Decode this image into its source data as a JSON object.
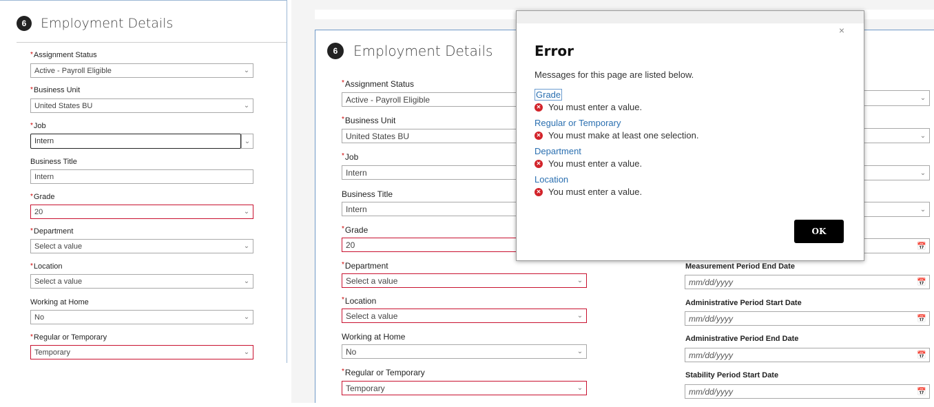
{
  "section": {
    "number": "6",
    "title": "Employment Details"
  },
  "left": {
    "fields": [
      {
        "label": "Assignment Status",
        "required": true,
        "value": "Active - Payroll Eligible"
      },
      {
        "label": "Business Unit",
        "required": true,
        "value": "United States BU"
      },
      {
        "label": "Job",
        "required": true,
        "value": "Intern"
      },
      {
        "label": "Business Title",
        "required": false,
        "value": "Intern"
      },
      {
        "label": "Grade",
        "required": true,
        "value": "20"
      },
      {
        "label": "Department",
        "required": true,
        "value": "Select a value"
      },
      {
        "label": "Location",
        "required": true,
        "value": "Select a value"
      },
      {
        "label": "Working at Home",
        "required": false,
        "value": "No"
      },
      {
        "label": "Regular or Temporary",
        "required": true,
        "value": "Temporary"
      }
    ]
  },
  "right": {
    "fields": [
      {
        "label": "Assignment Status",
        "required": true,
        "value": "Active - Payroll Eligible"
      },
      {
        "label": "Business Unit",
        "required": true,
        "value": "United States BU"
      },
      {
        "label": "Job",
        "required": true,
        "value": "Intern"
      },
      {
        "label": "Business Title",
        "required": false,
        "value": "Intern"
      },
      {
        "label": "Grade",
        "required": true,
        "value": "20"
      },
      {
        "label": "Department",
        "required": true,
        "value": "Select a value"
      },
      {
        "label": "Location",
        "required": true,
        "value": "Select a value"
      },
      {
        "label": "Working at Home",
        "required": false,
        "value": "No"
      },
      {
        "label": "Regular or Temporary",
        "required": true,
        "value": "Temporary"
      }
    ],
    "date_fields": [
      {
        "label": "Measurement Period End Date",
        "placeholder": "mm/dd/yyyy"
      },
      {
        "label": "Administrative Period Start Date",
        "placeholder": "mm/dd/yyyy"
      },
      {
        "label": "Administrative Period End Date",
        "placeholder": "mm/dd/yyyy"
      },
      {
        "label": "Stability Period Start Date",
        "placeholder": "mm/dd/yyyy"
      }
    ],
    "grade_side_placeholder": ""
  },
  "dialog": {
    "close": "×",
    "title": "Error",
    "subtitle": "Messages for this page are listed below.",
    "messages": [
      {
        "field": "Grade",
        "text": "You must enter a value."
      },
      {
        "field": "Regular or Temporary",
        "text": "You must make at least one selection."
      },
      {
        "field": "Department",
        "text": "You must enter a value."
      },
      {
        "field": "Location",
        "text": "You must enter a value."
      }
    ],
    "ok_label": "OK"
  },
  "icons": {
    "error": "error-x-icon",
    "chevron": "chevron-down-icon",
    "calendar": "calendar-icon",
    "close": "close-icon"
  },
  "colors": {
    "error_border": "#c8102e",
    "link": "#2a6fb0",
    "badge": "#222222"
  }
}
